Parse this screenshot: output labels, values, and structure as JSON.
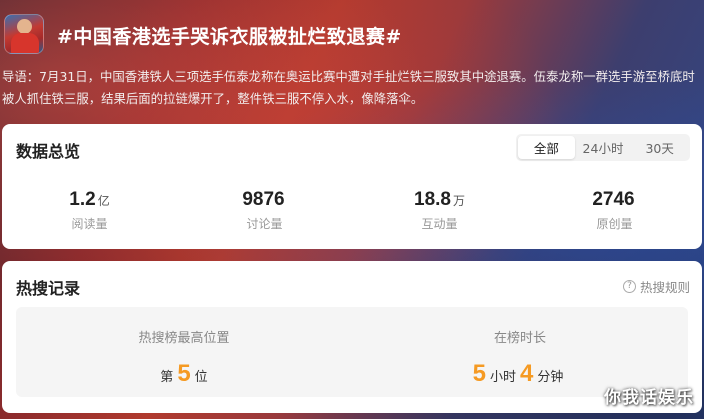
{
  "topic": {
    "title": "#中国香港选手哭诉衣服被扯烂致退赛#",
    "intro": "导语：7月31日，中国香港铁人三项选手伍泰龙称在奥运比赛中遭对手扯烂铁三服致其中途退赛。伍泰龙称一群选手游至桥底时被人抓住铁三服，结果后面的拉链爆开了，整件铁三服不停入水，像降落伞。"
  },
  "overview": {
    "title": "数据总览",
    "tabs": [
      "全部",
      "24小时",
      "30天"
    ],
    "active_tab": "全部",
    "stats": [
      {
        "value": "1.2",
        "unit": "亿",
        "label": "阅读量"
      },
      {
        "value": "9876",
        "unit": "",
        "label": "讨论量"
      },
      {
        "value": "18.8",
        "unit": "万",
        "label": "互动量"
      },
      {
        "value": "2746",
        "unit": "",
        "label": "原创量"
      }
    ]
  },
  "hot_search": {
    "title": "热搜记录",
    "rules_label": "热搜规则",
    "rules_icon": "?",
    "peak": {
      "label": "热搜榜最高位置",
      "prefix": "第",
      "value": "5",
      "suffix": "位"
    },
    "duration": {
      "label": "在榜时长",
      "hours": "5",
      "hours_unit": "小时",
      "minutes": "4",
      "minutes_unit": "分钟"
    }
  },
  "watermark": "你我话娱乐",
  "colors": {
    "accent_orange": "#f59a23",
    "card_bg": "#ffffff",
    "panel_bg": "#f5f5f5"
  }
}
